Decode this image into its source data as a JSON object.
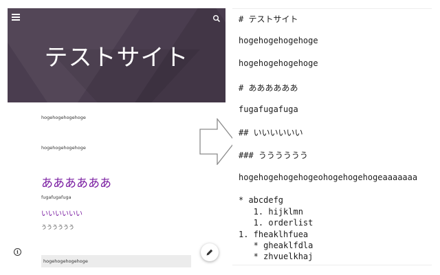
{
  "preview": {
    "hero_title": "テストサイト",
    "paragraph1": "hogehogehogehoge",
    "paragraph2": "hogehogehogehoge",
    "heading1": "ああああああ",
    "paragraph3": "fugafugafuga",
    "heading2": "いいいいいい",
    "heading3": "うううううう",
    "footer_text": "hogehogehogehoge",
    "colors": {
      "hero_bg": "#4a3d4f",
      "heading_accent": "#7b1fa2"
    },
    "icons": {
      "menu": "menu-icon",
      "search": "search-icon",
      "info": "info-icon",
      "edit": "pencil-icon"
    }
  },
  "arrow": {
    "icon": "right-arrow-icon"
  },
  "markdown": {
    "lines": [
      "# テストサイト",
      "hogehogehogehoge",
      "hogehogehogehoge",
      "# ああああああ",
      "fugafugafuga",
      "## いいいいいい",
      "### うううううう",
      "hogehogehogehogeohogehogehogeaaaaaaa",
      "* abcdefg",
      "   1. hijklmn",
      "   1. orderlist",
      "1. fheaklhfuea",
      "   * gheaklfdla",
      "   * zhvuelkhaj"
    ]
  }
}
